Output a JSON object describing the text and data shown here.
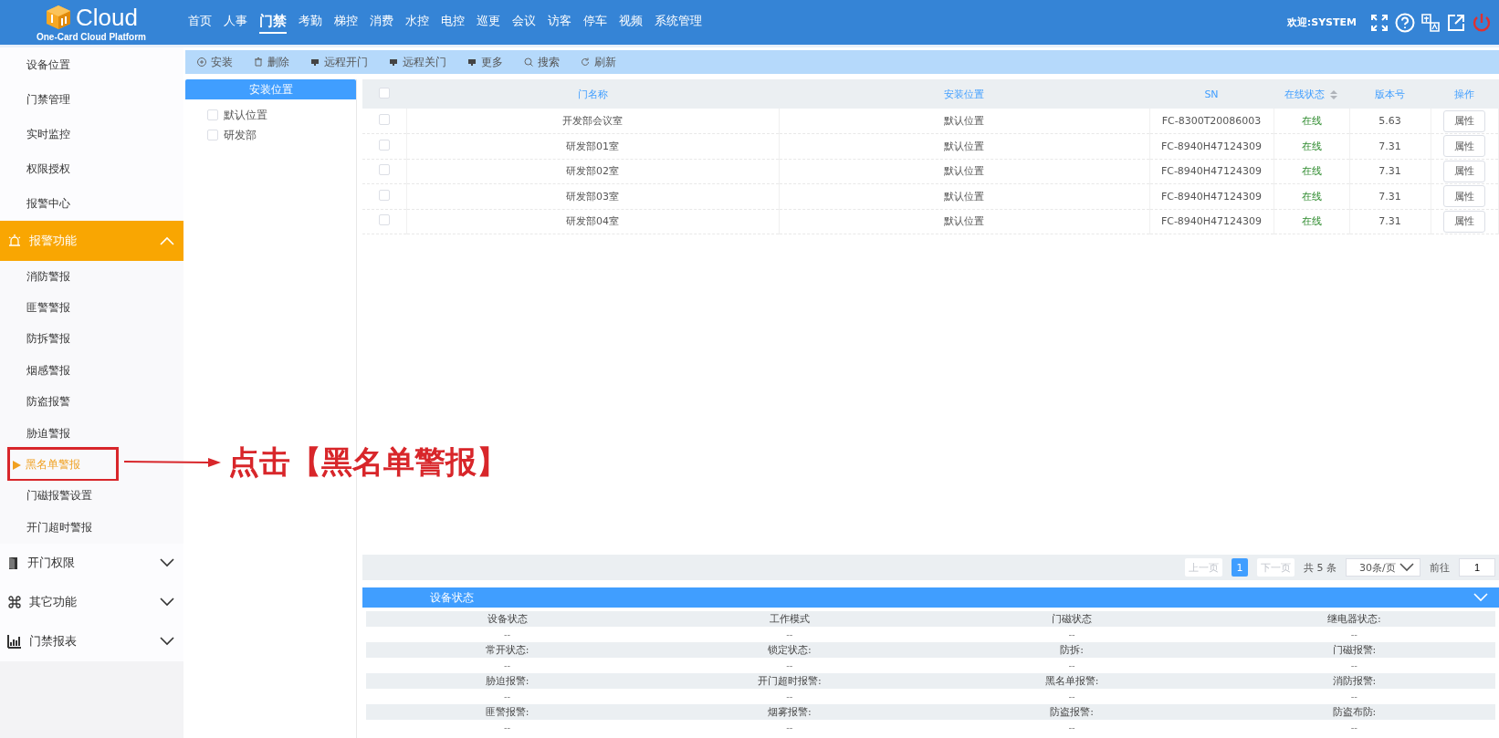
{
  "header": {
    "logo_title": "Cloud",
    "logo_subtitle": "One-Card Cloud Platform",
    "nav": [
      {
        "label": "首页",
        "selected": false
      },
      {
        "label": "人事",
        "selected": false
      },
      {
        "label": "门禁",
        "selected": true
      },
      {
        "label": "考勤",
        "selected": false
      },
      {
        "label": "梯控",
        "selected": false
      },
      {
        "label": "消费",
        "selected": false
      },
      {
        "label": "水控",
        "selected": false
      },
      {
        "label": "电控",
        "selected": false
      },
      {
        "label": "巡更",
        "selected": false
      },
      {
        "label": "会议",
        "selected": false
      },
      {
        "label": "访客",
        "selected": false
      },
      {
        "label": "停车",
        "selected": false
      },
      {
        "label": "视频",
        "selected": false
      },
      {
        "label": "系统管理",
        "selected": false
      }
    ],
    "welcome": "欢迎:SYSTEM"
  },
  "sidebar": {
    "links": [
      "设备位置",
      "门禁管理",
      "实时监控",
      "权限授权",
      "报警中心"
    ],
    "groups": [
      {
        "label": "报警功能",
        "expanded": true,
        "children": [
          {
            "label": "消防警报",
            "selected": false
          },
          {
            "label": "匪警警报",
            "selected": false
          },
          {
            "label": "防拆警报",
            "selected": false
          },
          {
            "label": "烟感警报",
            "selected": false
          },
          {
            "label": "防盗报警",
            "selected": false
          },
          {
            "label": "胁迫警报",
            "selected": false
          },
          {
            "label": "黑名单警报",
            "selected": true
          },
          {
            "label": "门磁报警设置",
            "selected": false
          },
          {
            "label": "开门超时警报",
            "selected": false
          }
        ]
      },
      {
        "label": "开门权限",
        "expanded": false
      },
      {
        "label": "其它功能",
        "expanded": false
      },
      {
        "label": "门禁报表",
        "expanded": false
      }
    ]
  },
  "annotation": {
    "text": "点击【黑名单警报】"
  },
  "toolbar": [
    "安装",
    "删除",
    "远程开门",
    "远程关门",
    "更多",
    "搜索",
    "刷新"
  ],
  "tree": {
    "title": "安装位置",
    "nodes": [
      {
        "label": "默认位置",
        "checked": false
      },
      {
        "label": "研发部",
        "checked": false
      }
    ]
  },
  "table": {
    "select_all": {
      "checked": false
    },
    "columns": [
      {
        "label": "门名称",
        "sortable": false
      },
      {
        "label": "安装位置",
        "sortable": false
      },
      {
        "label": "SN",
        "sortable": false
      },
      {
        "label": "在线状态",
        "sortable": true
      },
      {
        "label": "版本号",
        "sortable": false
      },
      {
        "label": "操作",
        "sortable": false
      }
    ],
    "rows": [
      {
        "checked": false,
        "name": "开发部会议室",
        "location": "默认位置",
        "sn": "FC-8300T20086003",
        "status": "在线",
        "version": "5.63",
        "action": "属性"
      },
      {
        "checked": false,
        "name": "研发部01室",
        "location": "默认位置",
        "sn": "FC-8940H47124309",
        "status": "在线",
        "version": "7.31",
        "action": "属性"
      },
      {
        "checked": false,
        "name": "研发部02室",
        "location": "默认位置",
        "sn": "FC-8940H47124309",
        "status": "在线",
        "version": "7.31",
        "action": "属性"
      },
      {
        "checked": false,
        "name": "研发部03室",
        "location": "默认位置",
        "sn": "FC-8940H47124309",
        "status": "在线",
        "version": "7.31",
        "action": "属性"
      },
      {
        "checked": false,
        "name": "研发部04室",
        "location": "默认位置",
        "sn": "FC-8940H47124309",
        "status": "在线",
        "version": "7.31",
        "action": "属性"
      }
    ]
  },
  "pagination": {
    "prev": "上一页",
    "pages": [
      {
        "label": "1",
        "selected": true
      }
    ],
    "next": "下一页",
    "total": "共 5 条",
    "page_size": "30条/页",
    "goto_label": "前往",
    "goto_value": "1"
  },
  "status_panel": {
    "title": "设备状态",
    "expanded": true,
    "fields": [
      {
        "label": "设备状态",
        "value": "--"
      },
      {
        "label": "工作模式",
        "value": "--"
      },
      {
        "label": "门磁状态",
        "value": "--"
      },
      {
        "label": "继电器状态:",
        "value": "--"
      },
      {
        "label": "常开状态:",
        "value": "--"
      },
      {
        "label": "锁定状态:",
        "value": "--"
      },
      {
        "label": "防拆:",
        "value": "--"
      },
      {
        "label": "门磁报警:",
        "value": "--"
      },
      {
        "label": "胁迫报警:",
        "value": "--"
      },
      {
        "label": "开门超时报警:",
        "value": "--"
      },
      {
        "label": "黑名单报警:",
        "value": "--"
      },
      {
        "label": "消防报警:",
        "value": "--"
      },
      {
        "label": "匪警报警:",
        "value": "--"
      },
      {
        "label": "烟雾报警:",
        "value": "--"
      },
      {
        "label": "防盗报警:",
        "value": "--"
      },
      {
        "label": "防盗布防:",
        "value": "--"
      }
    ]
  }
}
